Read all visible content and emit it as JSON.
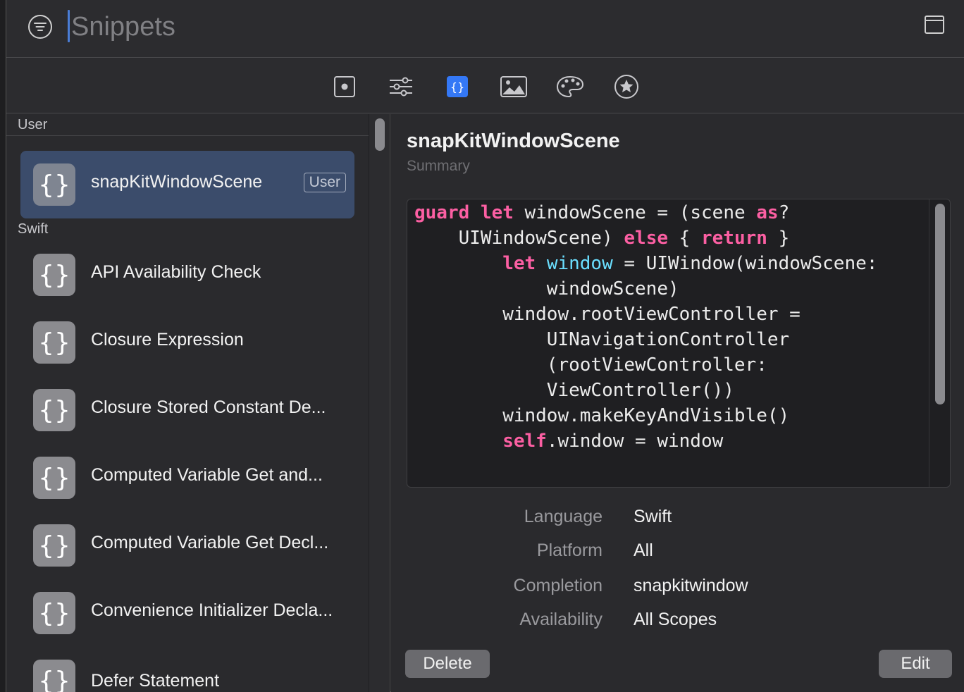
{
  "search": {
    "placeholder": "Snippets",
    "value": ""
  },
  "icons": {
    "filter": "line-3-horizontal-decrease-circle-icon",
    "layout": "sidebar-layout-icon",
    "tabs": [
      "views-tab-icon",
      "modifiers-tab-icon",
      "snippets-tab-icon",
      "media-tab-icon",
      "colors-tab-icon",
      "symbols-tab-icon"
    ]
  },
  "tabs": {
    "active_index": 2,
    "accent": "#3478f6"
  },
  "sidebar": {
    "sections": [
      {
        "header": "User"
      },
      {
        "header": "Swift"
      }
    ],
    "user_items": [
      {
        "label": "snapKitWindowScene",
        "badge": "User",
        "icon": "{}"
      }
    ],
    "swift_items": [
      {
        "label": "API Availability Check",
        "icon": "{}"
      },
      {
        "label": "Closure Expression",
        "icon": "{}"
      },
      {
        "label": "Closure Stored Constant De...",
        "icon": "{}"
      },
      {
        "label": "Computed Variable Get and...",
        "icon": "{}"
      },
      {
        "label": "Computed Variable Get Decl...",
        "icon": "{}"
      },
      {
        "label": "Convenience Initializer Decla...",
        "icon": "{}"
      },
      {
        "label": "Defer Statement",
        "icon": "{}"
      }
    ]
  },
  "detail": {
    "title": "snapKitWindowScene",
    "summary": "Summary",
    "code_lines": [
      {
        "indent": 0,
        "tokens": [
          {
            "t": "guard",
            "k": "kw"
          },
          {
            "t": " "
          },
          {
            "t": "let",
            "k": "kw"
          },
          {
            "t": " windowScene = (scene "
          },
          {
            "t": "as",
            "k": "kw"
          },
          {
            "t": "?"
          }
        ]
      },
      {
        "indent": 2,
        "tokens": [
          {
            "t": "UIWindowScene) "
          },
          {
            "t": "else",
            "k": "kw"
          },
          {
            "t": " { "
          },
          {
            "t": "return",
            "k": "kw"
          },
          {
            "t": " }"
          }
        ]
      },
      {
        "indent": 4,
        "tokens": [
          {
            "t": "let",
            "k": "kw"
          },
          {
            "t": " "
          },
          {
            "t": "window",
            "k": "ident"
          },
          {
            "t": " = UIWindow(windowScene:"
          }
        ]
      },
      {
        "indent": 6,
        "tokens": [
          {
            "t": "windowScene)"
          }
        ]
      },
      {
        "indent": 4,
        "tokens": [
          {
            "t": "window.rootViewController ="
          }
        ]
      },
      {
        "indent": 6,
        "tokens": [
          {
            "t": "UINavigationController"
          }
        ]
      },
      {
        "indent": 6,
        "tokens": [
          {
            "t": "(rootViewController:"
          }
        ]
      },
      {
        "indent": 6,
        "tokens": [
          {
            "t": "ViewController())"
          }
        ]
      },
      {
        "indent": 4,
        "tokens": [
          {
            "t": "window.makeKeyAndVisible()"
          }
        ]
      },
      {
        "indent": 4,
        "tokens": [
          {
            "t": "self",
            "k": "kw"
          },
          {
            "t": ".window = window"
          }
        ]
      }
    ],
    "meta": [
      {
        "key": "Language",
        "value": "Swift"
      },
      {
        "key": "Platform",
        "value": "All"
      },
      {
        "key": "Completion",
        "value": "snapkitwindow"
      },
      {
        "key": "Availability",
        "value": "All Scopes"
      }
    ],
    "delete_label": "Delete",
    "edit_label": "Edit"
  },
  "colors": {
    "keyword": "#fc5fa3",
    "identifier": "#6bdfff",
    "selection": "#3b4c6b"
  }
}
